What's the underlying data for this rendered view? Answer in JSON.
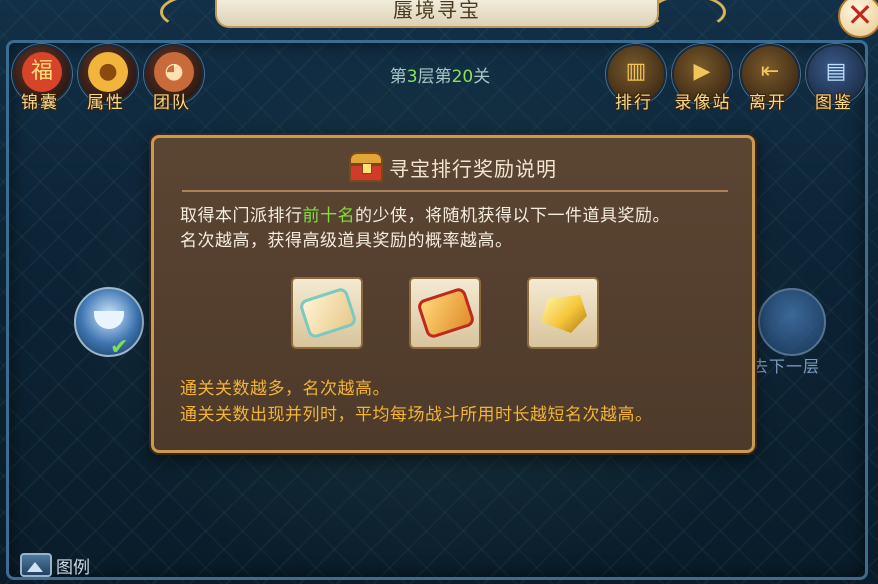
{
  "window": {
    "title": "蜃境寻宝"
  },
  "top_left_buttons": [
    {
      "label": "锦囊",
      "icon": "bag-icon"
    },
    {
      "label": "属性",
      "icon": "chick-icon"
    },
    {
      "label": "团队",
      "icon": "monkey-icon"
    }
  ],
  "top_right_buttons": [
    {
      "label": "排行",
      "icon": "podium-icon"
    },
    {
      "label": "录像站",
      "icon": "video-camera-icon"
    },
    {
      "label": "离开",
      "icon": "exit-door-icon"
    },
    {
      "label": "图鉴",
      "icon": "book-icon"
    }
  ],
  "stage": {
    "prefix": "第",
    "floor": "3",
    "mid": "层第",
    "level": "20",
    "suffix": "关"
  },
  "map": {
    "next_floor_label": "去下一层",
    "legend_label": "图例"
  },
  "modal": {
    "title": "寻宝排行奖励说明",
    "desc_part1": "取得本门派排行",
    "desc_highlight": "前十名",
    "desc_part2": "的少侠，将随机获得以下一件道具奖励。",
    "desc_line2": "名次越高，获得高级道具奖励的概率越高。",
    "reward_items": [
      "scroll-icon",
      "golden-scroll-icon",
      "gold-gem-icon"
    ],
    "note1": "通关关数越多，名次越高。",
    "note2": "通关关数出现并列时，平均每场战斗所用时长越短名次越高。"
  },
  "colors": {
    "highlight_green": "#7fe03a",
    "note_orange": "#f0b43a",
    "modal_border": "#c89a54"
  }
}
